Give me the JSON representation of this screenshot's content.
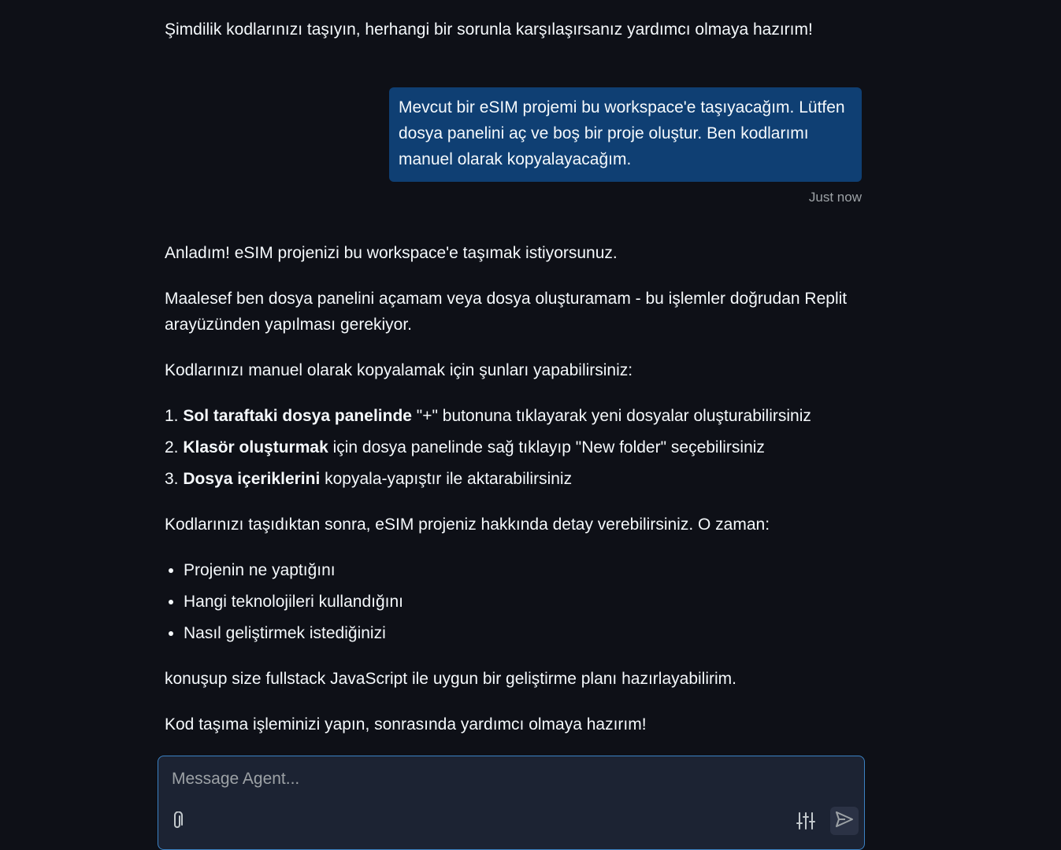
{
  "conversation": {
    "intro": "Şimdilik kodlarınızı taşıyın, herhangi bir sorunla karşılaşırsanız yardımcı olmaya hazırım!",
    "user_message": "Mevcut bir eSIM projemi bu workspace'e taşıyacağım. Lütfen dosya panelini aç ve boş bir proje oluştur. Ben kodlarımı manuel olarak kopyalayacağım.",
    "timestamp": "Just now",
    "agent": {
      "p1": "Anladım! eSIM projenizi bu workspace'e taşımak istiyorsunuz.",
      "p2": "Maalesef ben dosya panelini açamam veya dosya oluşturamam - bu işlemler doğrudan Replit arayüzünden yapılması gerekiyor.",
      "p3": "Kodlarınızı manuel olarak kopyalamak için şunları yapabilirsiniz:",
      "steps": [
        {
          "num": "1.",
          "bold": "Sol taraftaki dosya panelinde",
          "rest": " \"+\" butonuna tıklayarak yeni dosyalar oluşturabilirsiniz"
        },
        {
          "num": "2.",
          "bold": "Klasör oluşturmak",
          "rest": " için dosya panelinde sağ tıklayıp \"New folder\" seçebilirsiniz"
        },
        {
          "num": "3.",
          "bold": "Dosya içeriklerini",
          "rest": " kopyala-yapıştır ile aktarabilirsiniz"
        }
      ],
      "p4": "Kodlarınızı taşıdıktan sonra, eSIM projeniz hakkında detay verebilirsiniz. O zaman:",
      "bullets": [
        "Projenin ne yaptığını",
        "Hangi teknolojileri kullandığını",
        "Nasıl geliştirmek istediğinizi"
      ],
      "p5": "konuşup size fullstack JavaScript ile uygun bir geliştirme planı hazırlayabilirim.",
      "p6": "Kod taşıma işleminizi yapın, sonrasında yardımcı olmaya hazırım!"
    }
  },
  "composer": {
    "placeholder": "Message Agent...",
    "value": "",
    "attach_icon": "paperclip-icon",
    "settings_icon": "sliders-icon",
    "send_icon": "send-icon"
  },
  "colors": {
    "background": "#0e1017",
    "user_bubble": "#0f3f73",
    "composer_border": "#3b82c4",
    "text": "#f5f9fc",
    "muted": "#9da2a6"
  }
}
